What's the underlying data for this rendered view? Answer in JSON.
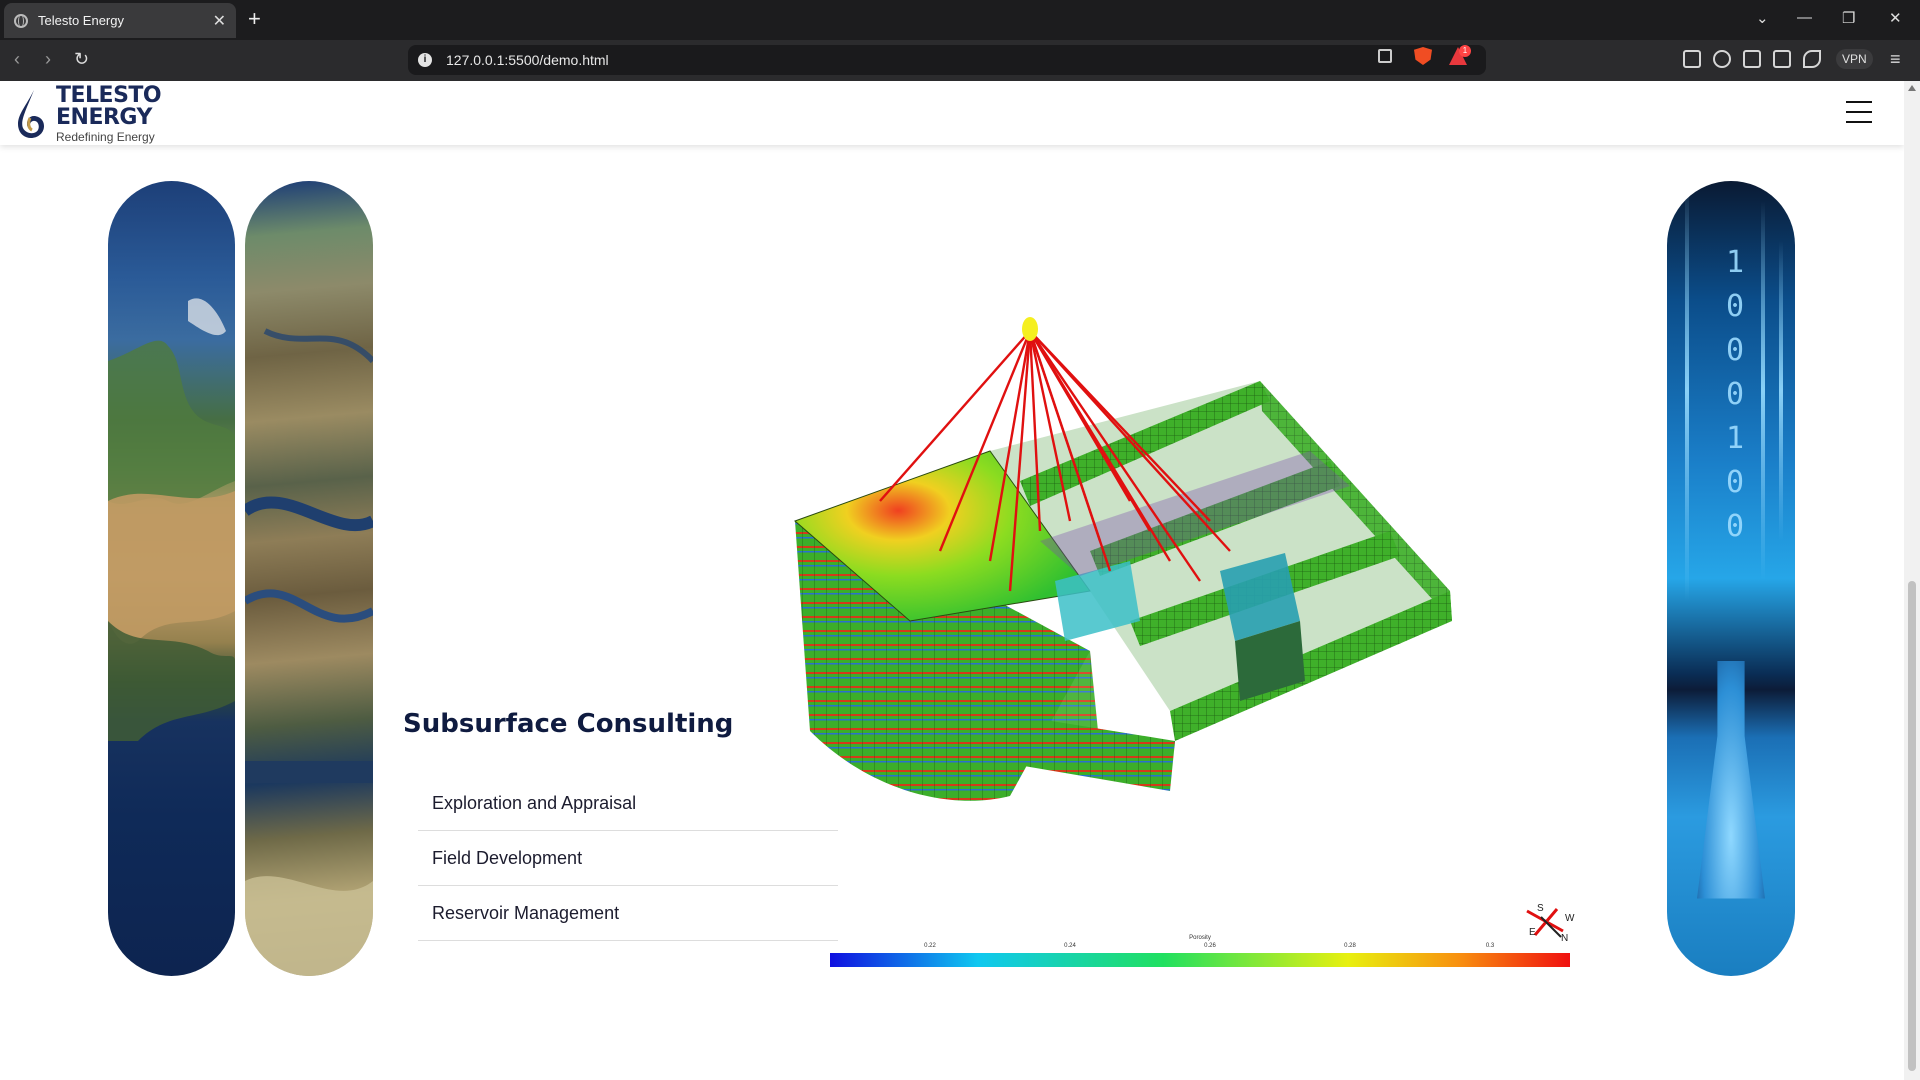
{
  "browser": {
    "tab_title": "Telesto Energy",
    "tab_close": "✕",
    "new_tab": "+",
    "url": "127.0.0.1:5500/demo.html",
    "rewards_badge": "1",
    "vpn_label": "VPN",
    "window_controls": [
      "⌄",
      "—",
      "❐",
      "✕"
    ]
  },
  "header": {
    "logo_line1": "TELESTO",
    "logo_line2": "ENERGY",
    "tagline": "Redefining Energy"
  },
  "section": {
    "title": "Subsurface Consulting",
    "services": [
      "Exploration and Appraisal",
      "Field Development",
      "Reservoir Management"
    ]
  },
  "pill3": {
    "binary": "1\n0\n0\n0\n1\n0\n0"
  },
  "model": {
    "colorbar_label": "Porosity",
    "colorbar_ticks": [
      "0.22",
      "0.24",
      "0.26",
      "0.28",
      "0.3"
    ],
    "compass": {
      "n": "N",
      "s": "S",
      "e": "E",
      "w": "W"
    }
  },
  "colors": {
    "heading": "#0f1b40",
    "brand_blue": "#1a2a5a",
    "wells": "#e01010"
  }
}
